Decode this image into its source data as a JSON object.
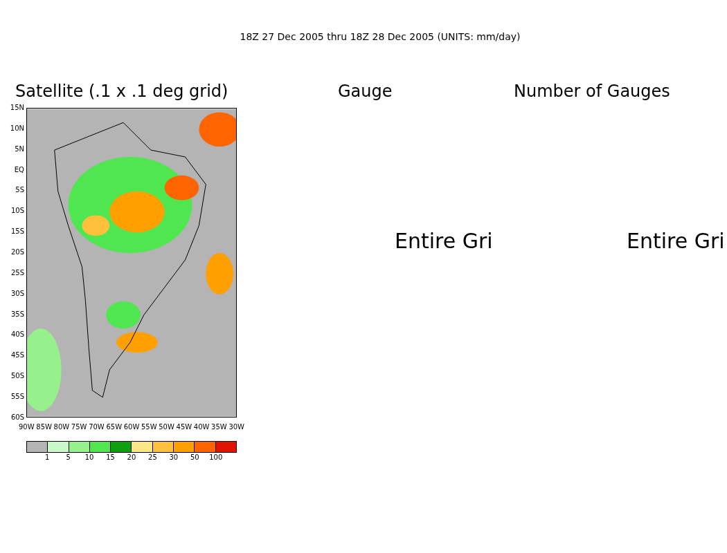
{
  "title": "18Z 27 Dec 2005 thru 18Z 28 Dec 2005 (UNITS: mm/day)",
  "panels": [
    {
      "kind": "map",
      "heading": "Satellite (.1 x .1 deg grid)",
      "lat_labels": [
        "15N",
        "10N",
        "5N",
        "EQ",
        "5S",
        "10S",
        "15S",
        "20S",
        "25S",
        "30S",
        "35S",
        "40S",
        "45S",
        "50S",
        "55S",
        "60S"
      ],
      "lon_labels": [
        "90W",
        "85W",
        "80W",
        "75W",
        "70W",
        "65W",
        "60W",
        "55W",
        "50W",
        "45W",
        "40W",
        "35W",
        "30W"
      ]
    },
    {
      "kind": "text",
      "heading": "Gauge",
      "message": "Entire Gri"
    },
    {
      "kind": "text",
      "heading": "Number of Gauges",
      "message": "Entire Gri"
    }
  ],
  "colorbar": {
    "segments": [
      {
        "color": "#b4b4b4"
      },
      {
        "color": "#c8fac8"
      },
      {
        "color": "#96f08c"
      },
      {
        "color": "#50e650"
      },
      {
        "color": "#0fa00f"
      },
      {
        "color": "#fae682"
      },
      {
        "color": "#ffc03c"
      },
      {
        "color": "#ffa000"
      },
      {
        "color": "#ff6400"
      },
      {
        "color": "#e11400"
      }
    ],
    "labels": [
      "1",
      "5",
      "10",
      "15",
      "20",
      "25",
      "30",
      "50",
      "100"
    ]
  }
}
